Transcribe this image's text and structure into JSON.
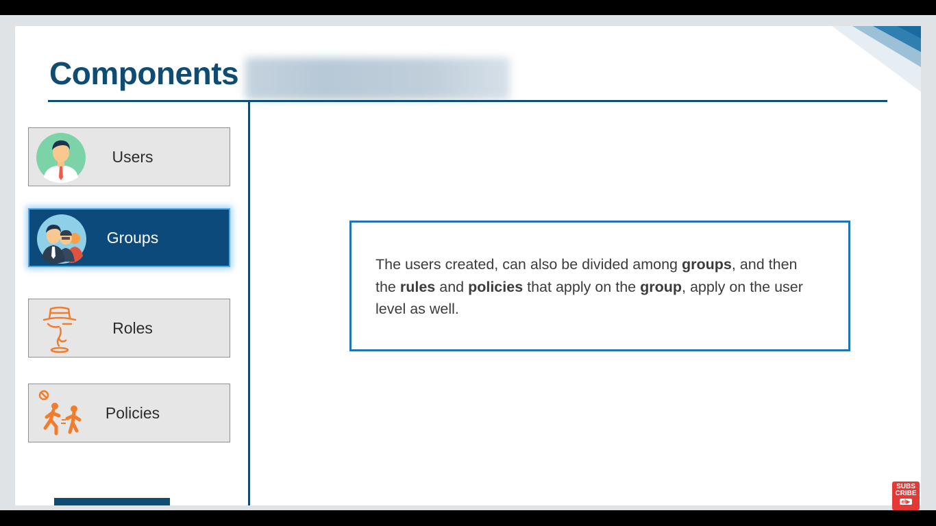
{
  "slide": {
    "title": "Components",
    "nav": [
      {
        "label": "Users",
        "icon": "user-avatar-icon",
        "active": false
      },
      {
        "label": "Groups",
        "icon": "group-avatar-icon",
        "active": true
      },
      {
        "label": "Roles",
        "icon": "role-detective-icon",
        "active": false
      },
      {
        "label": "Policies",
        "icon": "policy-no-fighting-icon",
        "active": false
      }
    ],
    "content": {
      "parts": [
        {
          "text": "The users created, can also be divided among ",
          "bold": false
        },
        {
          "text": "groups",
          "bold": true
        },
        {
          "text": ", and then the ",
          "bold": false
        },
        {
          "text": "rules",
          "bold": true
        },
        {
          "text": " and ",
          "bold": false
        },
        {
          "text": "policies",
          "bold": true
        },
        {
          "text": " that apply on the ",
          "bold": false
        },
        {
          "text": "group",
          "bold": true
        },
        {
          "text": ", apply on the user level as well.",
          "bold": false
        }
      ]
    }
  },
  "overlay": {
    "subscribe_line1": "SUBS",
    "subscribe_line2": "CRIBE",
    "subscribe_play": "el▶"
  },
  "colors": {
    "title": "#0f4c72",
    "active_nav": "#0d4a7c",
    "box_border": "#1f74b1",
    "icon_orange": "#f07c2e"
  }
}
